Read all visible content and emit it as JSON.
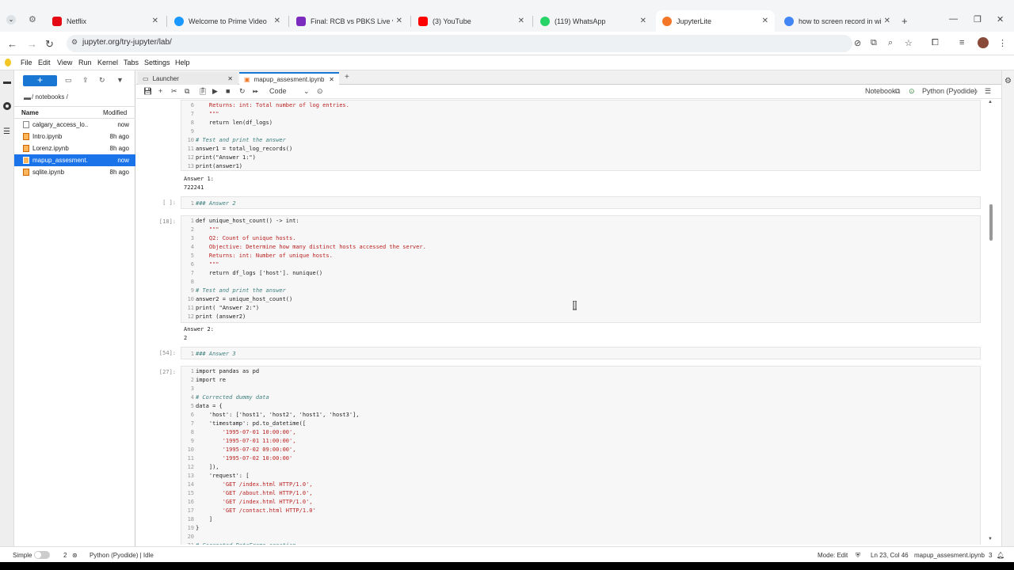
{
  "browser": {
    "tabs": [
      {
        "label": "Netflix",
        "color": "#e50914"
      },
      {
        "label": "Welcome to Prime Video",
        "color": "#1a98ff"
      },
      {
        "label": "Final: RCB vs PBKS Live video",
        "color": "#7b2cbf"
      },
      {
        "label": "(3) YouTube",
        "color": "#ff0000"
      },
      {
        "label": "(119) WhatsApp",
        "color": "#25d366"
      },
      {
        "label": "JupyterLite",
        "color": "#f37726"
      },
      {
        "label": "how to screen record in windo",
        "color": "#4285f4"
      }
    ],
    "url": "jupyter.org/try-jupyter/lab/"
  },
  "menu": [
    "File",
    "Edit",
    "View",
    "Run",
    "Kernel",
    "Tabs",
    "Settings",
    "Help"
  ],
  "filebrowser": {
    "new_label": "+",
    "path": "/ notebooks /",
    "col_name": "Name",
    "col_modified": "Modified",
    "files": [
      {
        "name": "calgary_access_lo...",
        "modified": "now",
        "type": "csv"
      },
      {
        "name": "Intro.ipynb",
        "modified": "8h ago",
        "type": "nb"
      },
      {
        "name": "Lorenz.ipynb",
        "modified": "8h ago",
        "type": "nb"
      },
      {
        "name": "mapup_assesment...",
        "modified": "now",
        "type": "nb",
        "selected": true
      },
      {
        "name": "sqlite.ipynb",
        "modified": "8h ago",
        "type": "nb"
      }
    ]
  },
  "doctabs": [
    {
      "label": "Launcher"
    },
    {
      "label": "mapup_assesment.ipynb"
    }
  ],
  "toolbar": {
    "cell_type": "Code",
    "notebook_label": "Notebook",
    "kernel_label": "Python (Pyodide)"
  },
  "cells": {
    "c1": {
      "lines": [
        {
          "n": "6",
          "t": "    Returns: int: Total number of log entries.",
          "c": "st"
        },
        {
          "n": "7",
          "t": "    \"\"\"",
          "c": "st"
        },
        {
          "n": "8",
          "t": "    return len(df_logs)",
          "c": ""
        },
        {
          "n": "9",
          "t": "",
          "c": ""
        },
        {
          "n": "10",
          "t": "# Test and print the answer",
          "c": "cm"
        },
        {
          "n": "11",
          "t": "answer1 = total_log_records()",
          "c": ""
        },
        {
          "n": "12",
          "t": "print(\"Answer 1:\")",
          "c": ""
        },
        {
          "n": "13",
          "t": "print(answer1)",
          "c": ""
        }
      ],
      "output": "Answer 1:\n722241"
    },
    "c2": {
      "prompt": "[ ]:",
      "line_no": "1",
      "text": "### Answer 2"
    },
    "c3": {
      "prompt": "[18]:",
      "lines": [
        {
          "n": "1",
          "t": "def unique_host_count() -> int:",
          "c": ""
        },
        {
          "n": "2",
          "t": "    \"\"\"",
          "c": "st"
        },
        {
          "n": "3",
          "t": "    Q2: Count of unique hosts.",
          "c": "st"
        },
        {
          "n": "4",
          "t": "    Objective: Determine how many distinct hosts accessed the server.",
          "c": "st"
        },
        {
          "n": "5",
          "t": "    Returns: int: Number of unique hosts.",
          "c": "st"
        },
        {
          "n": "6",
          "t": "    \"\"\"",
          "c": "st"
        },
        {
          "n": "7",
          "t": "    return df_logs ['host']. nunique()",
          "c": ""
        },
        {
          "n": "8",
          "t": "",
          "c": ""
        },
        {
          "n": "9",
          "t": "# Test and print the answer",
          "c": "cm"
        },
        {
          "n": "10",
          "t": "answer2 = unique_host_count()",
          "c": ""
        },
        {
          "n": "11",
          "t": "print( \"Answer 2:\")",
          "c": ""
        },
        {
          "n": "12",
          "t": "print (answer2)",
          "c": ""
        }
      ],
      "output": "Answer 2:\n2"
    },
    "c4": {
      "prompt": "[54]:",
      "line_no": "1",
      "text": "### Answer 3"
    },
    "c5": {
      "prompt": "[27]:",
      "lines": [
        {
          "n": "1",
          "t": "import pandas as pd",
          "c": ""
        },
        {
          "n": "2",
          "t": "import re",
          "c": ""
        },
        {
          "n": "3",
          "t": "",
          "c": ""
        },
        {
          "n": "4",
          "t": "# Corrected dummy data",
          "c": "cm"
        },
        {
          "n": "5",
          "t": "data = {",
          "c": ""
        },
        {
          "n": "6",
          "t": "    'host': ['host1', 'host2', 'host1', 'host3'],",
          "c": ""
        },
        {
          "n": "7",
          "t": "    'timestamp': pd.to_datetime([",
          "c": ""
        },
        {
          "n": "8",
          "t": "        '1995-07-01 10:00:00',",
          "c": "st"
        },
        {
          "n": "9",
          "t": "        '1995-07-01 11:00:00',",
          "c": "st"
        },
        {
          "n": "10",
          "t": "        '1995-07-02 09:00:00',",
          "c": "st"
        },
        {
          "n": "11",
          "t": "        '1995-07-02 10:00:00'",
          "c": "st"
        },
        {
          "n": "12",
          "t": "    ]),",
          "c": ""
        },
        {
          "n": "13",
          "t": "    'request': [",
          "c": ""
        },
        {
          "n": "14",
          "t": "        'GET /index.html HTTP/1.0',",
          "c": "st"
        },
        {
          "n": "15",
          "t": "        'GET /about.html HTTP/1.0',",
          "c": "st"
        },
        {
          "n": "16",
          "t": "        'GET /index.html HTTP/1.0',",
          "c": "st"
        },
        {
          "n": "17",
          "t": "        'GET /contact.html HTTP/1.0'",
          "c": "st"
        },
        {
          "n": "18",
          "t": "    ]",
          "c": ""
        },
        {
          "n": "19",
          "t": "}",
          "c": ""
        },
        {
          "n": "20",
          "t": "",
          "c": ""
        },
        {
          "n": "21",
          "t": "# Corrected DataFrame creation",
          "c": "cm"
        }
      ]
    }
  },
  "status": {
    "mode_label": "Simple",
    "count": "2",
    "kernel": "Python (Pyodide) | Idle",
    "edit_mode": "Mode: Edit",
    "position": "Ln 23, Col 46",
    "filename": "mapup_assesment.ipynb",
    "num": "3"
  }
}
